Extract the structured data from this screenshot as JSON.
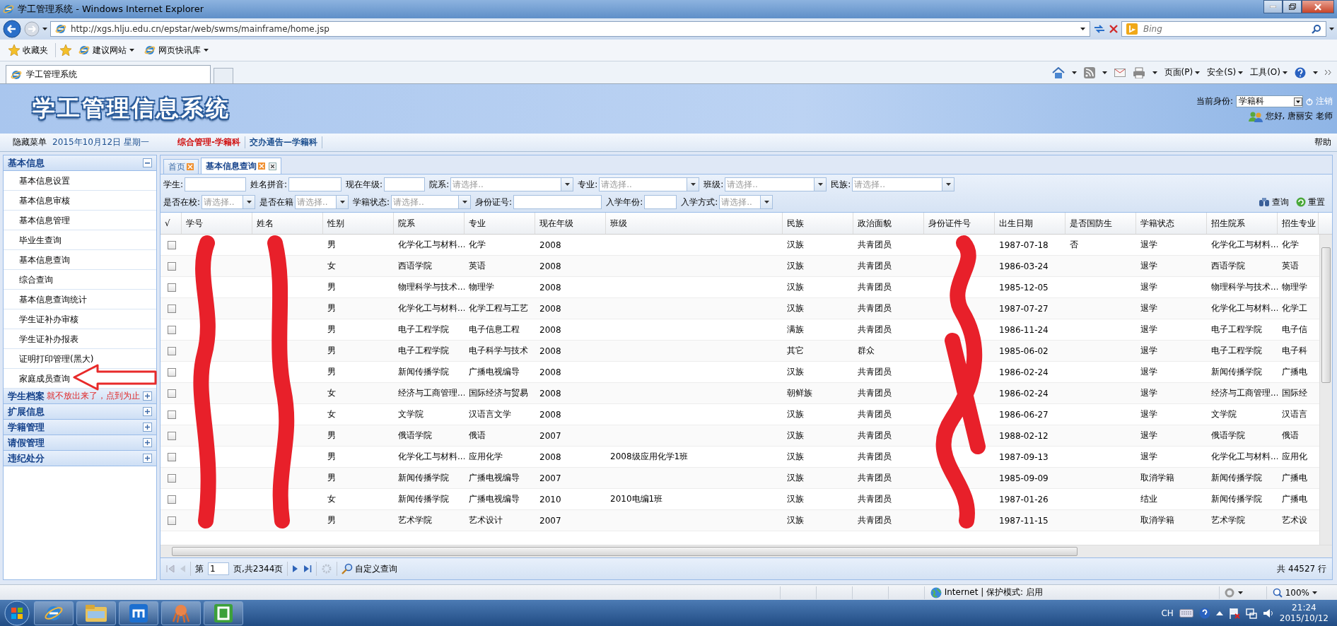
{
  "window": {
    "title": "学工管理系统 - Windows Internet Explorer"
  },
  "address_bar": {
    "url": "http://xgs.hlju.edu.cn/epstar/web/swms/mainframe/home.jsp"
  },
  "search_box": {
    "placeholder": "Bing"
  },
  "favorites_bar": {
    "favorites": "收藏夹",
    "links": [
      "建议网站",
      "网页快讯库"
    ]
  },
  "browser_tabs": [
    {
      "label": "学工管理系统",
      "selected": true
    }
  ],
  "command_bar": {
    "menus": [
      "页面(P)",
      "安全(S)",
      "工具(O)"
    ]
  },
  "app_header": {
    "title": "学工管理信息系统",
    "identity_label": "当前身份:",
    "identity_value": "学籍科",
    "logout": "注销",
    "greeting": "您好, 唐丽安 老师"
  },
  "menu_bar": {
    "hide_menu": "隐藏菜单",
    "date": "2015年10月12日 星期一",
    "menus": [
      {
        "label": "综合管理-学籍科",
        "selected": true
      },
      {
        "label": "交办通告—学籍科",
        "selected": false
      }
    ],
    "help": "帮助"
  },
  "sidebar": {
    "sections": [
      {
        "title": "基本信息",
        "expanded": true,
        "items": [
          "基本信息设置",
          "基本信息审核",
          "基本信息管理",
          "毕业生查询",
          "基本信息查询",
          "综合查询",
          "基本信息查询统计",
          "学生证补办审核",
          "学生证补办报表",
          "证明打印管理(黑大)",
          "家庭成员查询"
        ]
      },
      {
        "title": "学生档案",
        "expanded": false
      },
      {
        "title": "扩展信息",
        "expanded": false
      },
      {
        "title": "学籍管理",
        "expanded": false
      },
      {
        "title": "请假管理",
        "expanded": false
      },
      {
        "title": "违纪处分",
        "expanded": false
      }
    ]
  },
  "annotation": {
    "text": "就不放出来了，点到为止"
  },
  "content_tabs": [
    {
      "label": "首页",
      "selected": false,
      "closable": false
    },
    {
      "label": "基本信息查询",
      "selected": true,
      "closable": true
    }
  ],
  "filters": [
    [
      {
        "label": "学生:",
        "kind": "text"
      },
      {
        "label": "姓名拼音:",
        "kind": "text"
      },
      {
        "label": "现在年级:",
        "kind": "text"
      },
      {
        "label": "院系:",
        "kind": "select",
        "placeholder": "请选择.."
      },
      {
        "label": "专业:",
        "kind": "select",
        "placeholder": "请选择.."
      },
      {
        "label": "班级:",
        "kind": "select",
        "placeholder": "请选择.."
      },
      {
        "label": "民族:",
        "kind": "select",
        "placeholder": "请选择.."
      }
    ],
    [
      {
        "label": "是否在校:",
        "kind": "select",
        "placeholder": "请选择.."
      },
      {
        "label": "是否在籍",
        "kind": "select",
        "placeholder": "请选择.."
      },
      {
        "label": "学籍状态:",
        "kind": "select",
        "placeholder": "请选择.."
      },
      {
        "label": "身份证号:",
        "kind": "text"
      },
      {
        "label": "入学年份:",
        "kind": "text"
      },
      {
        "label": "入学方式:",
        "kind": "select",
        "placeholder": "请选择.."
      }
    ]
  ],
  "filter_buttons": [
    "查询",
    "重置"
  ],
  "table": {
    "columns": [
      "√",
      "学号",
      "姓名",
      "性别",
      "院系",
      "专业",
      "现在年级",
      "班级",
      "民族",
      "政治面貌",
      "身份证件号",
      "出生日期",
      "是否国防生",
      "学籍状态",
      "招生院系",
      "招生专业"
    ],
    "rows": [
      {
        "checked": false,
        "gender": "男",
        "department": "化学化工与材料...",
        "major": "化学",
        "grade": "2008",
        "ethnicity": "汉族",
        "political_status": "共青团员",
        "birth_date": "1987-07-18",
        "national_defense": "否",
        "status": "退学",
        "enroll_department": "化学化工与材料...",
        "enroll_major": "化学"
      },
      {
        "checked": false,
        "gender": "女",
        "department": "西语学院",
        "major": "英语",
        "grade": "2008",
        "ethnicity": "汉族",
        "political_status": "共青团员",
        "birth_date": "1986-03-24",
        "status": "退学",
        "enroll_department": "西语学院",
        "enroll_major": "英语"
      },
      {
        "checked": false,
        "gender": "男",
        "department": "物理科学与技术...",
        "major": "物理学",
        "grade": "2008",
        "ethnicity": "汉族",
        "political_status": "共青团员",
        "birth_date": "1985-12-05",
        "status": "退学",
        "enroll_department": "物理科学与技术...",
        "enroll_major": "物理学"
      },
      {
        "checked": false,
        "gender": "男",
        "department": "化学化工与材料...",
        "major": "化学工程与工艺",
        "grade": "2008",
        "ethnicity": "汉族",
        "political_status": "共青团员",
        "birth_date": "1987-07-27",
        "status": "退学",
        "enroll_department": "化学化工与材料...",
        "enroll_major": "化学工"
      },
      {
        "checked": false,
        "gender": "男",
        "department": "电子工程学院",
        "major": "电子信息工程",
        "grade": "2008",
        "ethnicity": "满族",
        "political_status": "共青团员",
        "birth_date": "1986-11-24",
        "status": "退学",
        "enroll_department": "电子工程学院",
        "enroll_major": "电子信"
      },
      {
        "checked": false,
        "gender": "男",
        "department": "电子工程学院",
        "major": "电子科学与技术",
        "grade": "2008",
        "ethnicity": "其它",
        "political_status": "群众",
        "birth_date": "1985-06-02",
        "status": "退学",
        "enroll_department": "电子工程学院",
        "enroll_major": "电子科"
      },
      {
        "checked": false,
        "gender": "男",
        "department": "新闻传播学院",
        "major": "广播电视编导",
        "grade": "2008",
        "ethnicity": "汉族",
        "political_status": "共青团员",
        "birth_date": "1986-02-24",
        "status": "退学",
        "enroll_department": "新闻传播学院",
        "enroll_major": "广播电"
      },
      {
        "checked": false,
        "gender": "女",
        "department": "经济与工商管理...",
        "major": "国际经济与贸易",
        "grade": "2008",
        "ethnicity": "朝鲜族",
        "political_status": "共青团员",
        "birth_date": "1986-02-24",
        "status": "退学",
        "enroll_department": "经济与工商管理...",
        "enroll_major": "国际经"
      },
      {
        "checked": false,
        "gender": "女",
        "department": "文学院",
        "major": "汉语言文学",
        "grade": "2008",
        "ethnicity": "汉族",
        "political_status": "共青团员",
        "birth_date": "1986-06-27",
        "status": "退学",
        "enroll_department": "文学院",
        "enroll_major": "汉语言"
      },
      {
        "checked": false,
        "gender": "男",
        "department": "俄语学院",
        "major": "俄语",
        "grade": "2007",
        "ethnicity": "汉族",
        "political_status": "共青团员",
        "birth_date": "1988-02-12",
        "status": "退学",
        "enroll_department": "俄语学院",
        "enroll_major": "俄语"
      },
      {
        "checked": false,
        "gender": "男",
        "department": "化学化工与材料...",
        "major": "应用化学",
        "grade": "2008",
        "class": "2008级应用化学1班",
        "ethnicity": "汉族",
        "political_status": "共青团员",
        "birth_date": "1987-09-13",
        "status": "退学",
        "enroll_department": "化学化工与材料...",
        "enroll_major": "应用化"
      },
      {
        "checked": false,
        "gender": "男",
        "department": "新闻传播学院",
        "major": "广播电视编导",
        "grade": "2007",
        "ethnicity": "汉族",
        "political_status": "共青团员",
        "birth_date": "1985-09-09",
        "status": "取消学籍",
        "enroll_department": "新闻传播学院",
        "enroll_major": "广播电"
      },
      {
        "checked": false,
        "gender": "女",
        "department": "新闻传播学院",
        "major": "广播电视编导",
        "grade": "2010",
        "class": "2010电编1班",
        "ethnicity": "汉族",
        "political_status": "共青团员",
        "birth_date": "1987-01-26",
        "status": "结业",
        "enroll_department": "新闻传播学院",
        "enroll_major": "广播电"
      },
      {
        "checked": false,
        "gender": "男",
        "department": "艺术学院",
        "major": "艺术设计",
        "grade": "2007",
        "ethnicity": "汉族",
        "political_status": "共青团员",
        "birth_date": "1987-11-15",
        "status": "取消学籍",
        "enroll_department": "艺术学院",
        "enroll_major": "艺术设"
      }
    ]
  },
  "pager": {
    "page_label": "第",
    "page": "1",
    "page_total": "页,共2344页",
    "custom_query": "自定义查询",
    "row_count": "共 44527 行"
  },
  "status_bar": {
    "zone": "Internet | 保护模式: 启用",
    "zoom": "100%"
  },
  "taskbar": {
    "language": "CH",
    "time": "21:24",
    "date": "2015/10/12"
  }
}
